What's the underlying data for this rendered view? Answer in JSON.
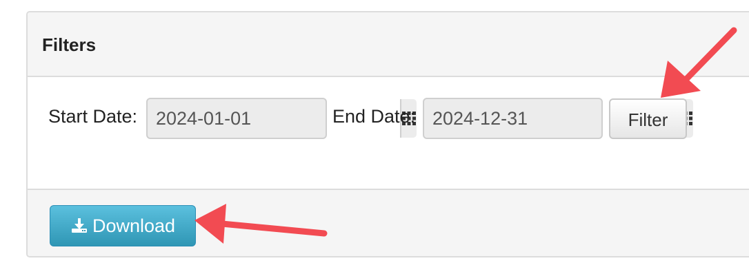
{
  "filters": {
    "title": "Filters",
    "start_date_label": "Start Date:",
    "start_date_value": "2024-01-01",
    "end_date_label": "End Date:",
    "end_date_value": "2024-12-31",
    "filter_button_label": "Filter"
  },
  "footer": {
    "download_button_label": "Download"
  },
  "icons": {
    "calendar": "grid-calendar-icon",
    "download": "download-tray-icon"
  },
  "colors": {
    "download_button": "#3aa8cc",
    "annotation_arrow": "#f24b52"
  }
}
